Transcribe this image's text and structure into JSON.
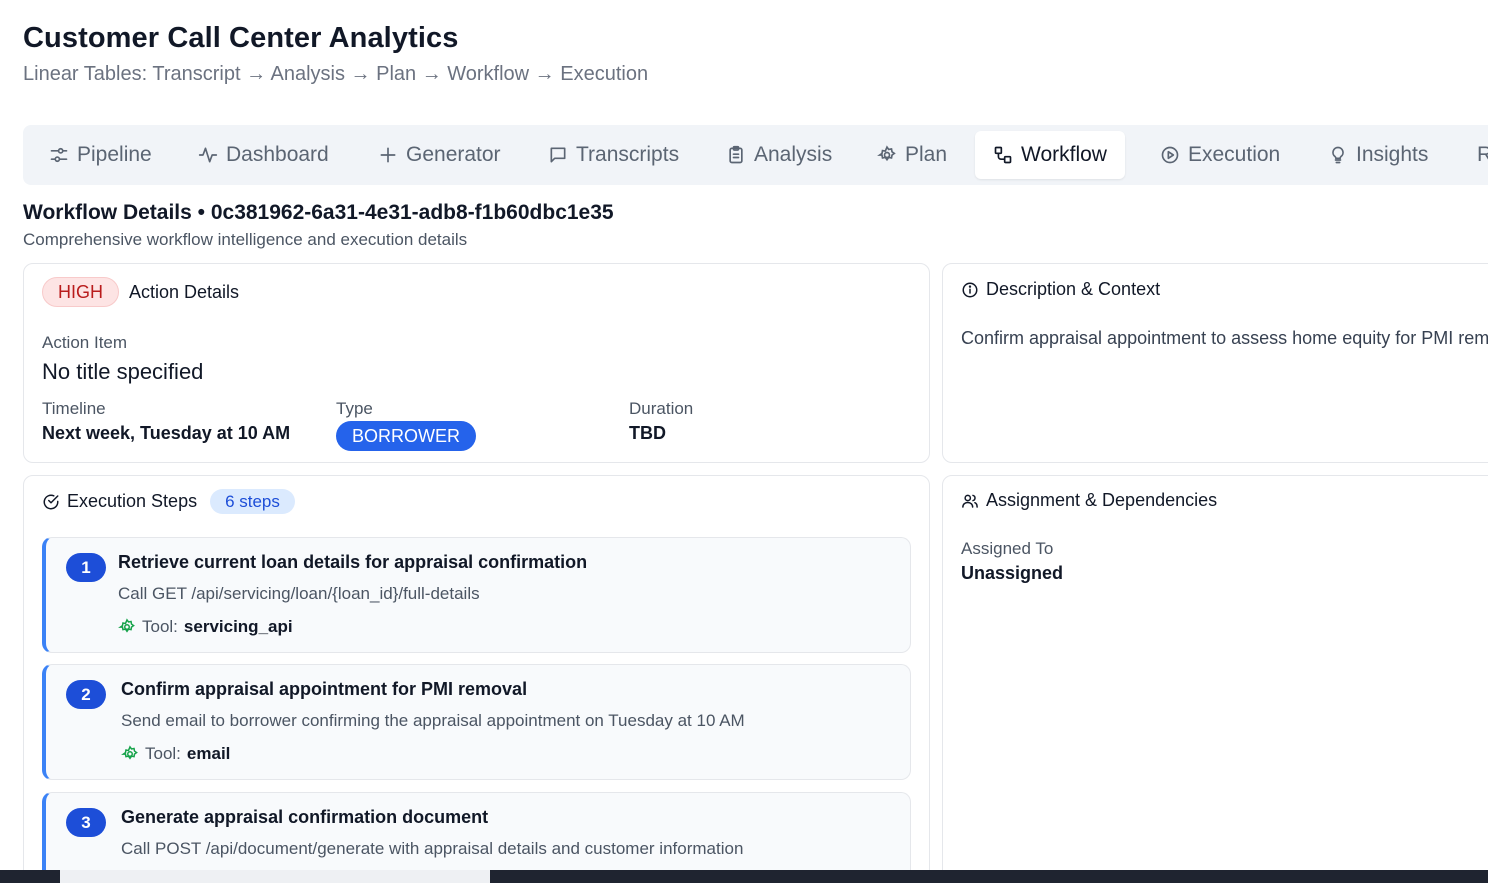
{
  "header": {
    "title": "Customer Call Center Analytics",
    "subtitle": "Linear Tables: Transcript → Analysis → Plan → Workflow → Execution"
  },
  "tabs": [
    {
      "label": "Pipeline",
      "icon": "sliders-icon"
    },
    {
      "label": "Dashboard",
      "icon": "activity-icon"
    },
    {
      "label": "Generator",
      "icon": "plus-icon"
    },
    {
      "label": "Transcripts",
      "icon": "message-square-icon"
    },
    {
      "label": "Analysis",
      "icon": "clipboard-icon"
    },
    {
      "label": "Plan",
      "icon": "gear-icon"
    },
    {
      "label": "Workflow",
      "icon": "workflow-icon",
      "active": true
    },
    {
      "label": "Execution",
      "icon": "play-circle-icon"
    },
    {
      "label": "Insights",
      "icon": "lightbulb-icon"
    },
    {
      "label": "R",
      "icon": ""
    }
  ],
  "workflow": {
    "title": "Workflow Details • 0c381962-6a31-4e31-adb8-f1b60dbc1e35",
    "subtitle": "Comprehensive workflow intelligence and execution details"
  },
  "action": {
    "priority": "HIGH",
    "heading": "Action Details",
    "item_label": "Action Item",
    "item_value": "No title specified",
    "timeline_label": "Timeline",
    "timeline_value": "Next week, Tuesday at 10 AM",
    "type_label": "Type",
    "type_value": "BORROWER",
    "duration_label": "Duration",
    "duration_value": "TBD"
  },
  "description": {
    "heading": "Description & Context",
    "text": "Confirm appraisal appointment to assess home equity for PMI rem"
  },
  "steps": {
    "heading": "Execution Steps",
    "count": "6 steps",
    "tool_label": "Tool:",
    "items": [
      {
        "num": "1",
        "title": "Retrieve current loan details for appraisal confirmation",
        "desc": "Call GET /api/servicing/loan/{loan_id}/full-details",
        "tool": "servicing_api"
      },
      {
        "num": "2",
        "title": "Confirm appraisal appointment for PMI removal",
        "desc": "Send email to borrower confirming the appraisal appointment on Tuesday at 10 AM",
        "tool": "email"
      },
      {
        "num": "3",
        "title": "Generate appraisal confirmation document",
        "desc": "Call POST /api/document/generate with appraisal details and customer information",
        "tool": ""
      }
    ]
  },
  "assignment": {
    "heading": "Assignment & Dependencies",
    "assigned_label": "Assigned To",
    "assigned_value": "Unassigned"
  },
  "colors": {
    "accent": "#2563eb",
    "priority_high_bg": "#fde4e4",
    "priority_high_text": "#b91c1c",
    "tool_icon": "#16a34a"
  }
}
